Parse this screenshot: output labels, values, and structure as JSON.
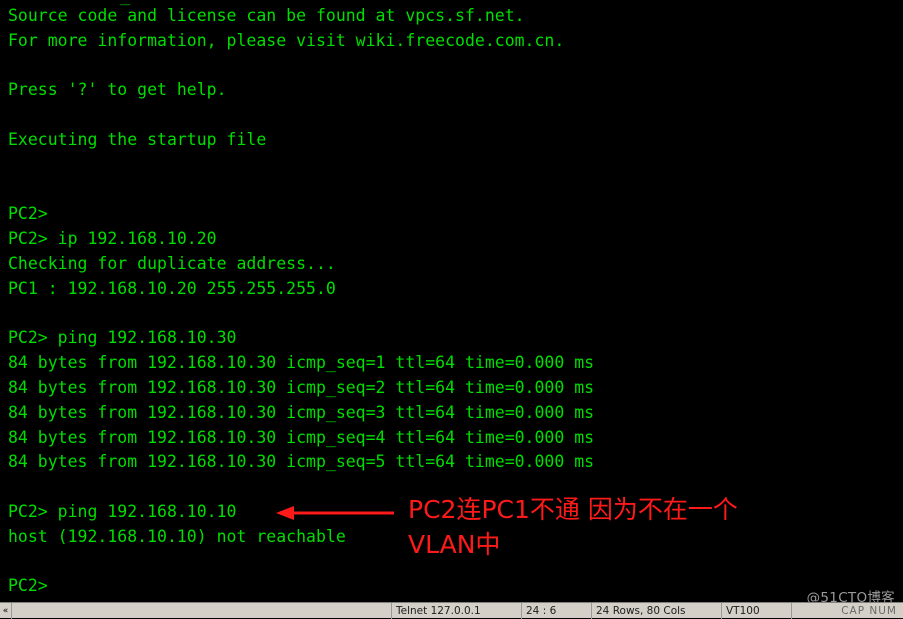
{
  "window": {
    "top_fragment": "_",
    "watermark": "@51CTO博客"
  },
  "terminal": {
    "lines": [
      "Source code and license can be found at vpcs.sf.net.",
      "For more information, please visit wiki.freecode.com.cn.",
      "",
      "Press '?' to get help.",
      "",
      "Executing the startup file",
      "",
      "",
      "PC2>",
      "PC2> ip 192.168.10.20",
      "Checking for duplicate address...",
      "PC1 : 192.168.10.20 255.255.255.0",
      "",
      "PC2> ping 192.168.10.30",
      "84 bytes from 192.168.10.30 icmp_seq=1 ttl=64 time=0.000 ms",
      "84 bytes from 192.168.10.30 icmp_seq=2 ttl=64 time=0.000 ms",
      "84 bytes from 192.168.10.30 icmp_seq=3 ttl=64 time=0.000 ms",
      "84 bytes from 192.168.10.30 icmp_seq=4 ttl=64 time=0.000 ms",
      "84 bytes from 192.168.10.30 icmp_seq=5 ttl=64 time=0.000 ms",
      "",
      "PC2> ping 192.168.10.10",
      "host (192.168.10.10) not reachable",
      "",
      "PC2>"
    ],
    "text_color": "#00dd00",
    "background_color": "#000000"
  },
  "annotation": {
    "text": "PC2连PC1不通 因为不在一个\nVLAN中",
    "color": "#ff1a1a"
  },
  "statusbar": {
    "menu_glyph": "«",
    "connection": "Telnet 127.0.0.1",
    "cursor_position": "24 : 6",
    "screen_size": "24 Rows, 80 Cols",
    "emulation": "VT100",
    "caps_indicator": "CAP NUM"
  }
}
